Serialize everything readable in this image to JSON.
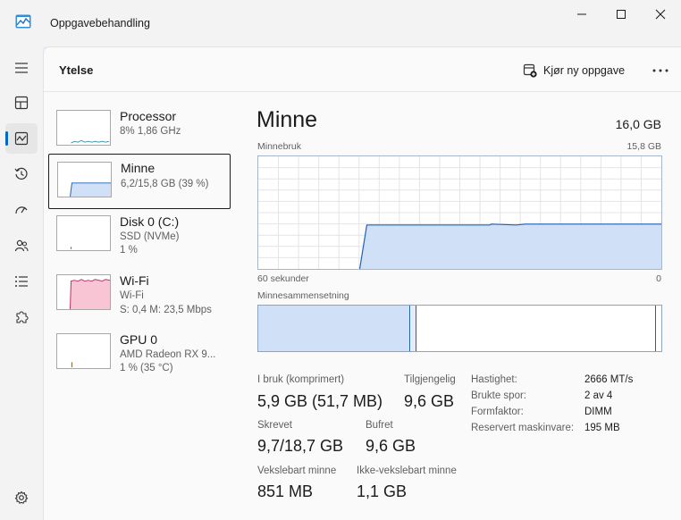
{
  "window": {
    "title": "Oppgavebehandling"
  },
  "header": {
    "page_title": "Ytelse",
    "run_task_label": "Kjør ny oppgave"
  },
  "nav": {
    "items": [
      "menu",
      "processes",
      "performance",
      "app-history",
      "startup-apps",
      "users",
      "details",
      "services",
      "settings"
    ],
    "active": "performance"
  },
  "sidebar": {
    "items": [
      {
        "name": "Processor",
        "sub1": "8%  1,86 GHz",
        "sub2": ""
      },
      {
        "name": "Minne",
        "sub1": "6,2/15,8 GB (39 %)",
        "sub2": ""
      },
      {
        "name": "Disk 0 (C:)",
        "sub1": "SSD (NVMe)",
        "sub2": "1 %"
      },
      {
        "name": "Wi-Fi",
        "sub1": "Wi-Fi",
        "sub2": "S: 0,4  M: 23,5 Mbps"
      },
      {
        "name": "GPU 0",
        "sub1": "AMD Radeon RX 9...",
        "sub2": "1 %  (35 °C)"
      }
    ]
  },
  "main": {
    "title": "Minne",
    "total": "16,0 GB",
    "usage_label": "Minnebruk",
    "usage_max": "15,8 GB",
    "time_left": "60 sekunder",
    "time_right": "0",
    "composition_label": "Minnesammensetning",
    "usage_fraction": 0.39,
    "stats": {
      "in_use_label": "I bruk (komprimert)",
      "in_use_value": "5,9 GB (51,7 MB)",
      "available_label": "Tilgjengelig",
      "available_value": "9,6 GB",
      "committed_label": "Skrevet",
      "committed_value": "9,7/18,7 GB",
      "cached_label": "Bufret",
      "cached_value": "9,6 GB",
      "paged_label": "Vekslebart minne",
      "paged_value": "851 MB",
      "nonpaged_label": "Ikke-vekslebart minne",
      "nonpaged_value": "1,1 GB"
    },
    "specs": [
      {
        "label": "Hastighet:",
        "value": "2666 MT/s"
      },
      {
        "label": "Brukte spor:",
        "value": "2 av 4"
      },
      {
        "label": "Formfaktor:",
        "value": "DIMM"
      },
      {
        "label": "Reservert maskinvare:",
        "value": "195 MB"
      }
    ]
  },
  "colors": {
    "accent": "#0067c0",
    "memory_line": "#1e62b8",
    "memory_fill": "#cfe0f7",
    "wifi_fill": "#f7c5d3",
    "wifi_line": "#c0285a",
    "cpu_line": "#2f8fa8"
  }
}
